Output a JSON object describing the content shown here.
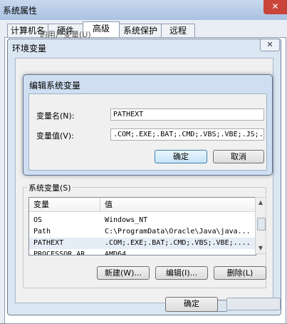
{
  "system_properties": {
    "title": "系统属性",
    "tabs": [
      "计算机名",
      "硬件",
      "高级",
      "系统保护",
      "远程"
    ],
    "active_tab": "高级"
  },
  "env_window": {
    "title": "环境变量",
    "user_vars_label": "的用户变量(U)",
    "system_vars_label": "系统变量(S)",
    "columns": [
      "变量",
      "值"
    ],
    "rows": [
      {
        "name": "OS",
        "value": "Windows_NT"
      },
      {
        "name": "Path",
        "value": "C:\\ProgramData\\Oracle\\Java\\java..."
      },
      {
        "name": "PATHEXT",
        "value": ".COM;.EXE;.BAT;.CMD;.VBS;.VBE;...."
      },
      {
        "name": "PROCESSOR_AR",
        "value": "AMD64"
      }
    ],
    "buttons": {
      "new": "新建(W)...",
      "edit": "编辑(I)...",
      "delete": "删除(L)"
    },
    "ok": "确定"
  },
  "edit_dialog": {
    "title": "编辑系统变量",
    "name_label": "变量名(N):",
    "value_label": "变量值(V):",
    "name_value": "PATHEXT",
    "value_value": ".COM;.EXE;.BAT;.CMD;.VBS;.VBE;.JS;.",
    "ok": "确定",
    "cancel": "取消"
  },
  "colors": {
    "accent": "#3c7fb1",
    "selected_row": "#e5edf6"
  }
}
